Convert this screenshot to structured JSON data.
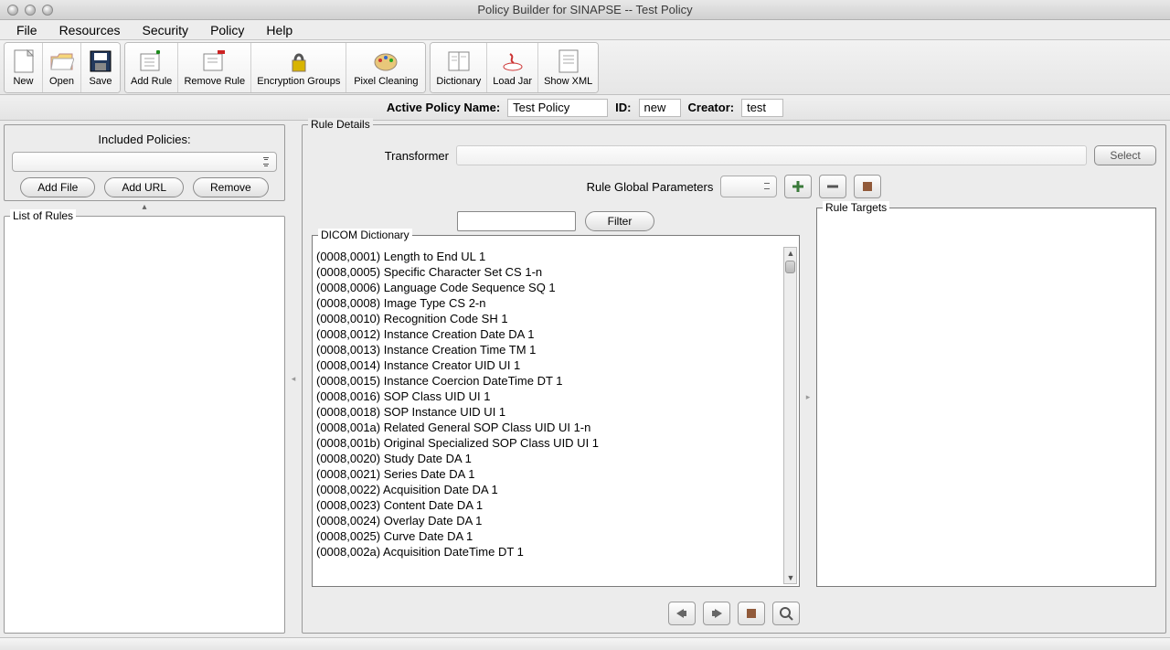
{
  "window": {
    "title": "Policy Builder for SINAPSE -- Test Policy"
  },
  "menubar": [
    "File",
    "Resources",
    "Security",
    "Policy",
    "Help"
  ],
  "toolbar": {
    "group1": [
      {
        "id": "new",
        "label": "New"
      },
      {
        "id": "open",
        "label": "Open"
      },
      {
        "id": "save",
        "label": "Save"
      }
    ],
    "group2": [
      {
        "id": "add-rule",
        "label": "Add Rule"
      },
      {
        "id": "remove-rule",
        "label": "Remove Rule"
      },
      {
        "id": "encryption-groups",
        "label": "Encryption Groups"
      },
      {
        "id": "pixel-cleaning",
        "label": "Pixel Cleaning"
      }
    ],
    "group3": [
      {
        "id": "dictionary",
        "label": "Dictionary"
      },
      {
        "id": "load-jar",
        "label": "Load Jar"
      },
      {
        "id": "show-xml",
        "label": "Show XML"
      }
    ]
  },
  "info": {
    "policy_name_label": "Active Policy Name:",
    "policy_name_value": "Test Policy",
    "id_label": "ID:",
    "id_value": "new",
    "creator_label": "Creator:",
    "creator_value": "test"
  },
  "left": {
    "included_label": "Included Policies:",
    "buttons": {
      "add_file": "Add File",
      "add_url": "Add URL",
      "remove": "Remove"
    },
    "rules_title": "List of Rules"
  },
  "details": {
    "title": "Rule Details",
    "transformer_label": "Transformer",
    "select_label": "Select",
    "global_label": "Rule Global Parameters",
    "filter_label": "Filter",
    "dict_title": "DICOM Dictionary",
    "targets_title": "Rule Targets",
    "dict_entries": [
      "(0008,0001) Length to End UL 1",
      "(0008,0005) Specific Character Set CS 1-n",
      "(0008,0006) Language Code Sequence SQ 1",
      "(0008,0008) Image Type CS 2-n",
      "(0008,0010) Recognition Code SH 1",
      "(0008,0012) Instance Creation Date DA 1",
      "(0008,0013) Instance Creation Time TM 1",
      "(0008,0014) Instance Creator UID UI 1",
      "(0008,0015) Instance Coercion DateTime DT 1",
      "(0008,0016) SOP Class UID UI 1",
      "(0008,0018) SOP Instance UID UI 1",
      "(0008,001a) Related General SOP Class UID UI 1-n",
      "(0008,001b) Original Specialized SOP Class UID UI 1",
      "(0008,0020) Study Date DA 1",
      "(0008,0021) Series Date DA 1",
      "(0008,0022) Acquisition Date DA 1",
      "(0008,0023) Content Date DA 1",
      "(0008,0024) Overlay Date DA 1",
      "(0008,0025) Curve Date DA 1",
      "(0008,002a) Acquisition DateTime DT 1"
    ]
  }
}
